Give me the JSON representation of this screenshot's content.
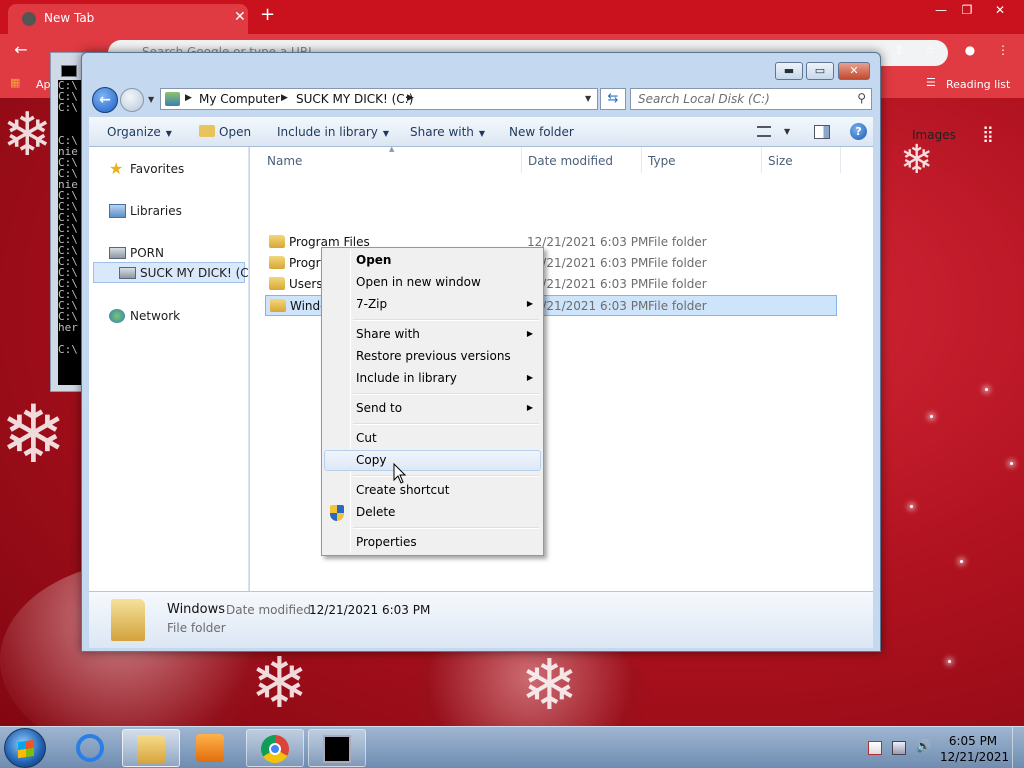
{
  "chrome": {
    "tab_title": "New Tab",
    "omnibox_placeholder": "Search Google or type a URL",
    "bookmark_apps": "Ap",
    "reading_list": "Reading list",
    "google_links": "Images"
  },
  "cmd": {
    "lines": [
      "C:\\",
      "C:\\",
      "C:\\",
      "",
      "",
      "C:\\",
      "nie",
      "C:\\",
      "C:\\",
      "nie",
      "C:\\",
      "C:\\",
      "C:\\",
      "C:\\",
      "C:\\",
      "C:\\",
      "C:\\",
      "C:\\",
      "C:\\",
      "C:\\",
      "C:\\",
      "C:\\",
      "her",
      "",
      "C:\\"
    ]
  },
  "explorer": {
    "address": {
      "segments": [
        "My Computer",
        "SUCK MY DICK! (C:)"
      ]
    },
    "search_placeholder": "Search Local Disk (C:)",
    "toolbar": {
      "organize": "Organize",
      "open": "Open",
      "include_in_library": "Include in library",
      "share_with": "Share with",
      "new_folder": "New folder"
    },
    "nav": {
      "favorites": "Favorites",
      "libraries": "Libraries",
      "porn": "PORN",
      "drive": "SUCK MY DICK! (C:)",
      "network": "Network"
    },
    "columns": {
      "name": "Name",
      "date_modified": "Date modified",
      "type": "Type",
      "size": "Size"
    },
    "rows": [
      {
        "name": "Program Files",
        "date": "12/21/2021 6:03 PM",
        "type": "File folder"
      },
      {
        "name": "Program Files (x86)",
        "date": "12/21/2021 6:03 PM",
        "type": "File folder"
      },
      {
        "name": "Users",
        "date": "12/21/2021 6:03 PM",
        "type": "File folder"
      },
      {
        "name": "Windo",
        "date": "12/21/2021 6:03 PM",
        "type": "File folder"
      }
    ],
    "details": {
      "name": "Windows",
      "date_label": "Date modified:",
      "date_value": "12/21/2021 6:03 PM",
      "type": "File folder"
    }
  },
  "context_menu": {
    "items": [
      {
        "label": "Open"
      },
      {
        "label": "Open in new window"
      },
      {
        "label": "7-Zip"
      },
      {
        "label": "Share with"
      },
      {
        "label": "Restore previous versions"
      },
      {
        "label": "Include in library"
      },
      {
        "label": "Send to"
      },
      {
        "label": "Cut"
      },
      {
        "label": "Copy"
      },
      {
        "label": "Create shortcut"
      },
      {
        "label": "Delete"
      },
      {
        "label": "Properties"
      }
    ]
  },
  "taskbar": {
    "time": "6:05 PM",
    "date": "12/21/2021"
  },
  "colors": {
    "desktop_red": "#b0121f",
    "selection_blue": "#cde4fb",
    "taskbar": "#8aa4c4"
  }
}
